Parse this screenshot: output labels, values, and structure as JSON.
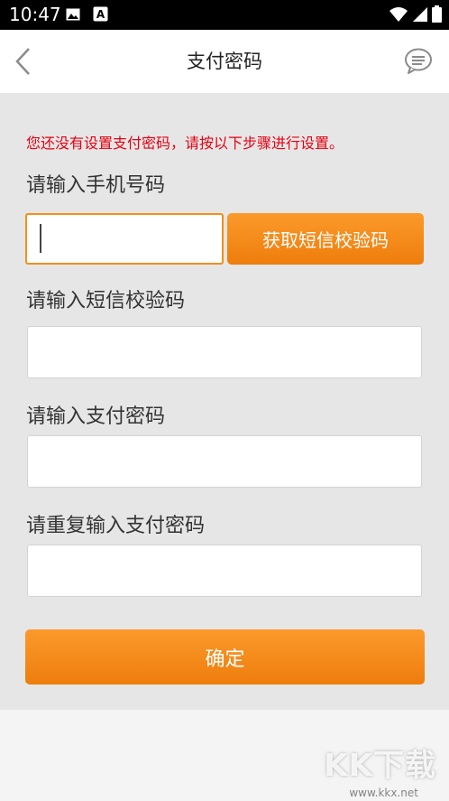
{
  "status_bar": {
    "time": "10:47",
    "icons": [
      "image-icon",
      "a-badge-icon",
      "wifi-icon",
      "signal-icon",
      "battery-icon"
    ],
    "a_badge": "A"
  },
  "header": {
    "title": "支付密码",
    "icons": [
      "back-chevron-icon",
      "message-icon"
    ]
  },
  "form": {
    "notice": "您还没有设置支付密码，请按以下步骤进行设置。",
    "phone_label": "请输入手机号码",
    "phone_value": "",
    "sms_button_label": "获取短信校验码",
    "sms_code_label": "请输入短信校验码",
    "sms_code_value": "",
    "password_label": "请输入支付密码",
    "password_value": "",
    "repeat_password_label": "请重复输入支付密码",
    "repeat_password_value": "",
    "confirm_label": "确定"
  },
  "watermark": {
    "logo": "KK下载",
    "url": "www.kkx.net"
  },
  "colors": {
    "accent": "#f3901a",
    "notice": "#e60012",
    "content_bg": "#e6e6e6"
  }
}
